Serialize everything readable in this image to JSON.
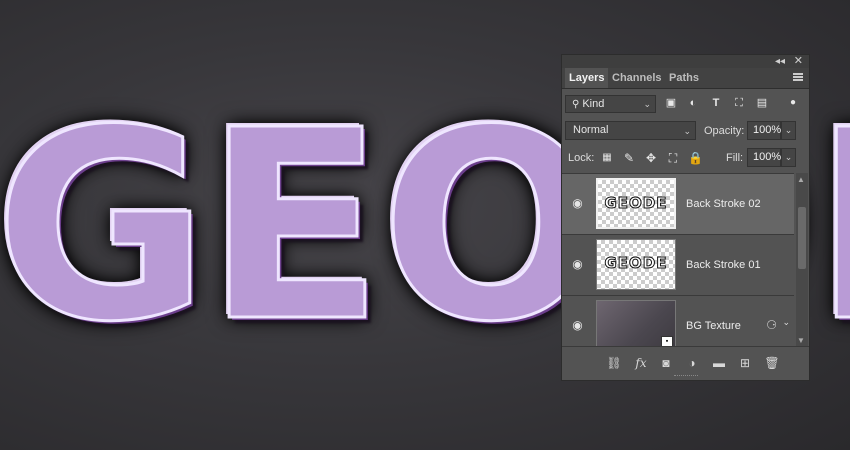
{
  "canvas": {
    "artwork_text": "GEODE"
  },
  "panel": {
    "tabs": [
      {
        "label": "Layers",
        "active": true
      },
      {
        "label": "Channels",
        "active": false
      },
      {
        "label": "Paths",
        "active": false
      }
    ],
    "filter": {
      "kind_label": "Kind"
    },
    "blend_mode": "Normal",
    "opacity_label": "Opacity:",
    "opacity_value": "100%",
    "lock_label": "Lock:",
    "fill_label": "Fill:",
    "fill_value": "100%",
    "layers": [
      {
        "name": "Back Stroke 02",
        "thumb_text": "GEODE",
        "selected": true,
        "visible": true
      },
      {
        "name": "Back Stroke 01",
        "thumb_text": "GEODE",
        "selected": false,
        "visible": true
      },
      {
        "name": "BG Texture",
        "thumb_text": "",
        "selected": false,
        "visible": true,
        "smart_object": true,
        "has_effects": true
      }
    ],
    "footer_icons": [
      "link-icon",
      "fx-icon",
      "mask-icon",
      "adjustment-icon",
      "folder-icon",
      "new-layer-icon",
      "trash-icon"
    ]
  }
}
